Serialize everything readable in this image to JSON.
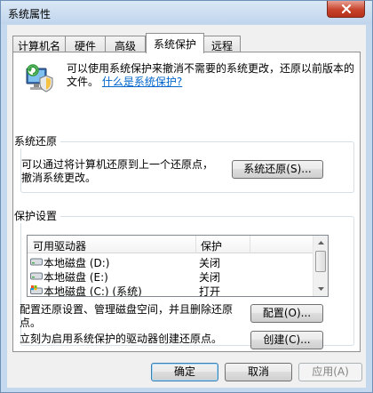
{
  "window": {
    "title": "系统属性",
    "close_icon": "close-icon"
  },
  "tabs": [
    {
      "label": "计算机名",
      "active": false
    },
    {
      "label": "硬件",
      "active": false
    },
    {
      "label": "高级",
      "active": false
    },
    {
      "label": "系统保护",
      "active": true
    },
    {
      "label": "远程",
      "active": false
    }
  ],
  "info": {
    "icon": "system-protection-icon",
    "text": "可以使用系统保护来撤消不需要的系统更改，还原以前版本的文件。",
    "link": "什么是系统保护?"
  },
  "restore": {
    "title": "系统还原",
    "description": "可以通过将计算机还原到上一个还原点，撤消系统更改。",
    "button": "系统还原(S)..."
  },
  "protection": {
    "title": "保护设置",
    "columns": [
      "可用驱动器",
      "保护"
    ],
    "rows": [
      {
        "drive": "本地磁盘 (D:)",
        "protection": "关闭",
        "icon": "drive-icon"
      },
      {
        "drive": "本地磁盘 (E:)",
        "protection": "关闭",
        "icon": "drive-icon"
      },
      {
        "drive": "本地磁盘 (C:) (系统)",
        "protection": "打开",
        "icon": "system-drive-icon"
      }
    ],
    "configure_text": "配置还原设置、管理磁盘空间，并且删除还原点。",
    "configure_button": "配置(O)...",
    "create_text": "立刻为启用系统保护的驱动器创建还原点。",
    "create_button": "创建(C)..."
  },
  "footer": {
    "ok": "确定",
    "cancel": "取消",
    "apply": "应用(A)"
  },
  "colors": {
    "link": "#0066cc",
    "title_bar": "#c4d8ee",
    "close_button": "#c7432b"
  }
}
